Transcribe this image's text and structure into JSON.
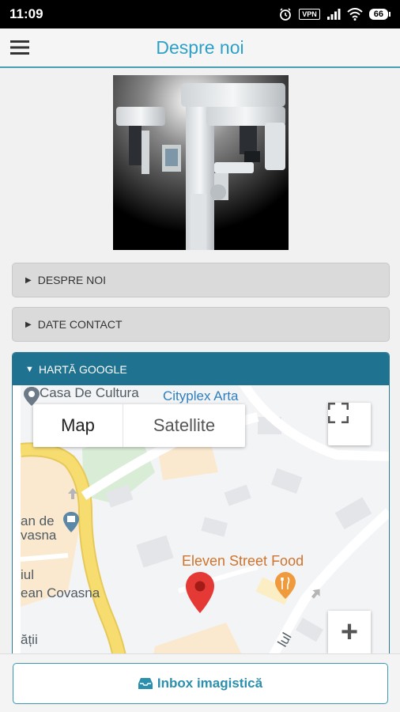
{
  "status_bar": {
    "time": "11:09",
    "vpn": "VPN",
    "battery": "66"
  },
  "header": {
    "title": "Despre noi",
    "menu_icon": "hamburger-icon"
  },
  "accordion": {
    "items": [
      {
        "label": "DESPRE NOI",
        "expanded": false
      },
      {
        "label": "DATE CONTACT",
        "expanded": false
      },
      {
        "label": "HARTĂ GOOGLE",
        "expanded": true
      }
    ]
  },
  "map": {
    "type_control": {
      "map": "Map",
      "satellite": "Satellite",
      "selected": "Map"
    },
    "labels": {
      "casa": "Casa De Cultura",
      "cityplex": "Cityplex Arta",
      "an_de": "an de",
      "vasna": "vasna",
      "iul": "iul",
      "ean_covasna": "ean Covasna",
      "atii": "ății",
      "eleven": "Eleven Street Food",
      "lul": "lul"
    },
    "zoom_in_label": "+",
    "colors": {
      "primary_road": "#f7dc6f",
      "park": "#d8ecd6",
      "pin": "#e53935",
      "food_pin": "#f09a3e"
    }
  },
  "bottom": {
    "inbox_label": "Inbox imagistică",
    "inbox_icon": "inbox-icon"
  },
  "colors": {
    "accent": "#2ca0c6",
    "accordion_open_header": "#1f7391",
    "accordion_closed": "#dadada"
  }
}
